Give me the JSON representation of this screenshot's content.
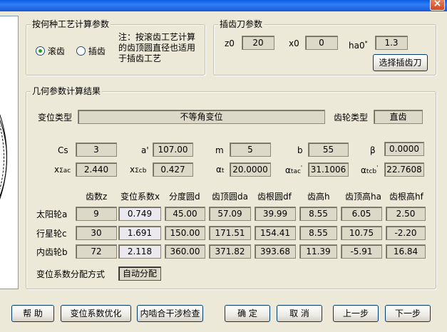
{
  "window": {
    "close_glyph": "×"
  },
  "process": {
    "legend": "按何种工艺计算参数",
    "radio_hob": "滚齿",
    "radio_shape": "插齿",
    "note": [
      "注：按滚齿工艺计算",
      "的齿顶圆直径也适用",
      "于插齿工艺"
    ]
  },
  "cutter": {
    "legend": "插齿刀参数",
    "z0_label": "z0",
    "z0": "20",
    "x0_label": "x0",
    "x0": "0",
    "ha0_label": "ha0",
    "ha0_sup": "*",
    "ha0": "1.3",
    "select_button": "选择插齿刀"
  },
  "geometry": {
    "legend": "几何参数计算结果",
    "shift_type_label": "变位类型",
    "shift_type": "不等角变位",
    "gear_type_label": "齿轮类型",
    "gear_type": "直齿",
    "cs_label": "Cs",
    "cs": "3",
    "a_label": "a'",
    "a": "107.00",
    "m_label": "m",
    "m": "5",
    "b_label": "b",
    "b": "55",
    "beta_label": "β",
    "beta": "0.0000",
    "xsac_main": "x",
    "xsac_sub": "Σac",
    "xsac": "2.440",
    "xscb_main": "x",
    "xscb_sub": "Σcb",
    "xscb": "0.427",
    "at_main": "α",
    "at_sub": "t",
    "at": "20.0000",
    "atac_main": "α",
    "atac_sub": "tac",
    "atac_sup": "'",
    "atac": "31.1006",
    "atcb_main": "α",
    "atcb_sub": "tcb",
    "atcb_sup": "'",
    "atcb": "22.7608",
    "table": {
      "headers": [
        "齿数z",
        "变位系数x",
        "分度圆d",
        "齿顶圆da",
        "齿根圆df",
        "齿高h",
        "齿顶高ha",
        "齿根高hf"
      ],
      "rows": [
        {
          "label": "太阳轮a",
          "values": [
            "9",
            "0.749",
            "45.00",
            "57.09",
            "39.99",
            "8.55",
            "6.05",
            "2.50"
          ]
        },
        {
          "label": "行星轮c",
          "values": [
            "30",
            "1.691",
            "150.00",
            "171.51",
            "154.41",
            "8.55",
            "10.75",
            "-2.20"
          ]
        },
        {
          "label": "内齿轮b",
          "values": [
            "72",
            "2.118",
            "360.00",
            "371.82",
            "393.68",
            "11.39",
            "-5.91",
            "16.84"
          ]
        }
      ]
    },
    "dist_label": "变位系数分配方式",
    "dist_value": "自动分配"
  },
  "buttons": {
    "help": "帮 助",
    "optimize": "变位系数优化",
    "interference": "内啮合干涉检查",
    "ok": "确 定",
    "cancel": "取 消",
    "prev": "上一步",
    "next": "下一步"
  }
}
